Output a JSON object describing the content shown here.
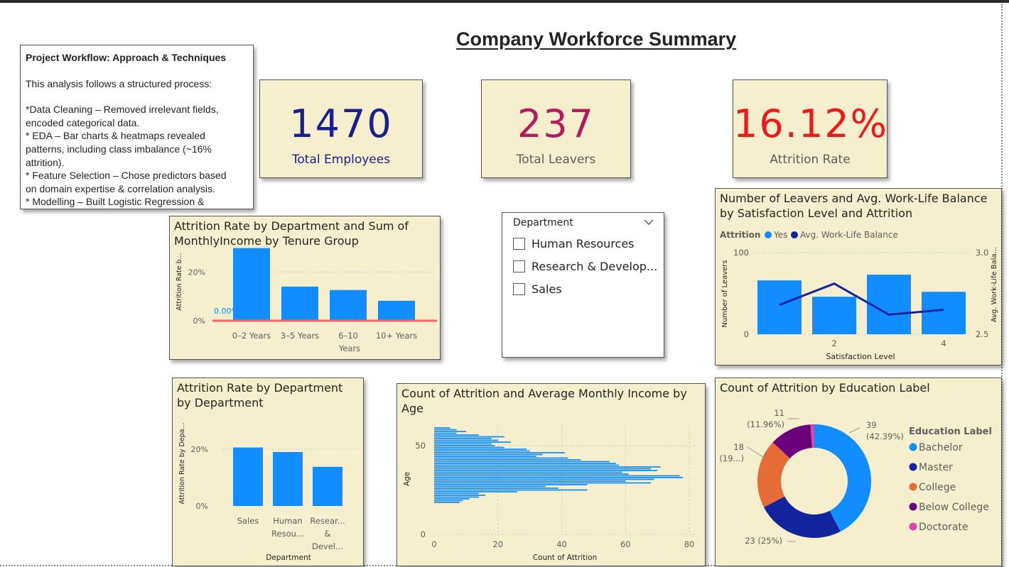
{
  "page": {
    "title": "Company Workforce Summary"
  },
  "notes": {
    "heading": "Project Workflow: Approach & Techniques",
    "intro": "This analysis follows a structured process:",
    "items": [
      "*Data Cleaning – Removed irrelevant fields, encoded categorical data.",
      "* EDA – Bar charts & heatmaps revealed patterns, including class imbalance (~16% attrition).",
      "* Feature Selection – Chose predictors based on domain expertise & correlation analysis.",
      "* Modelling – Built Logistic Regression &"
    ]
  },
  "kpis": [
    {
      "value": "1470",
      "label": "Total Employees",
      "color": "#1a1f8f"
    },
    {
      "value": "237",
      "label": "Total Leavers",
      "color": "#b5195e"
    },
    {
      "value": "16.12%",
      "label": "Attrition Rate",
      "color": "#f01818"
    }
  ],
  "slicer": {
    "title": "Department",
    "chevron": "chevron-down-icon",
    "options": [
      "Human Resources",
      "Research & Develop...",
      "Sales"
    ]
  },
  "colors": {
    "bar": "#118dff",
    "dark": "#12239e",
    "orange": "#e66c37",
    "purple": "#6b007b",
    "pink": "#e044a7",
    "panel": "#f5efce",
    "refline": "#fd625e"
  },
  "chart_data": [
    {
      "id": "tenure",
      "type": "bar",
      "title": "Attrition Rate by Department and Sum of MonthlyIncome by Tenure Group",
      "title_lines": [
        "Attrition Rate by Department and Sum of",
        "MonthlyIncome by Tenure Group"
      ],
      "ylabel": "Attrition Rate b...",
      "xlabel": "Years",
      "categories": [
        "0–2 Years",
        "3–5 Years",
        "6–10",
        "10+ Years"
      ],
      "values": [
        29.8,
        14.0,
        12.6,
        8.2
      ],
      "yticks": [
        "0%",
        "20%"
      ],
      "ylim": [
        0,
        32
      ],
      "annotation": "0.00%",
      "reference_line": 0
    },
    {
      "id": "dept",
      "type": "bar",
      "title": "Attrition Rate by Department by Department",
      "title_lines": [
        "Attrition Rate by Department",
        "by Department"
      ],
      "ylabel": "Attrition Rate by Depa...",
      "xlabel": "Department",
      "categories": [
        [
          "Sales"
        ],
        [
          "Human",
          "Resou..."
        ],
        [
          "Resear...",
          "&",
          "Devel..."
        ]
      ],
      "values": [
        20.6,
        19.0,
        13.8
      ],
      "yticks": [
        "0%",
        "20%"
      ],
      "ylim": [
        0,
        27
      ]
    },
    {
      "id": "age",
      "type": "bar",
      "orientation": "horizontal",
      "title": "Count of Attrition and Average Monthly Income by Age",
      "title_lines": [
        "Count of Attrition and Average Monthly Income by",
        "Age"
      ],
      "xlabel": "Count of Attrition",
      "ylabel": "Age",
      "xticks": [
        0,
        20,
        40,
        60,
        80
      ],
      "yticks": [
        0,
        50
      ],
      "xlim": [
        0,
        82
      ],
      "ylim": [
        0,
        62
      ],
      "ages": [
        18,
        19,
        20,
        21,
        22,
        23,
        24,
        25,
        26,
        27,
        28,
        29,
        30,
        31,
        32,
        33,
        34,
        35,
        36,
        37,
        38,
        39,
        40,
        41,
        42,
        43,
        44,
        45,
        46,
        47,
        48,
        49,
        50,
        51,
        52,
        53,
        54,
        55,
        56,
        57,
        58,
        59,
        60
      ],
      "counts": [
        8,
        9,
        11,
        14,
        16,
        14,
        26,
        48,
        39,
        35,
        48,
        68,
        60,
        69,
        78,
        77,
        61,
        59,
        70,
        68,
        71,
        58,
        57,
        55,
        46,
        42,
        32,
        34,
        41,
        30,
        29,
        22,
        19,
        18,
        24,
        20,
        18,
        22,
        14,
        7,
        10,
        7,
        5
      ]
    },
    {
      "id": "satisfaction",
      "type": "bar",
      "title": "Number of Leavers and Avg. Work-Life Balance by Satisfaction Level and Attrition",
      "title_lines": [
        "Number of Leavers and Avg. Work-Life Balance",
        "by Satisfaction Level and Attrition"
      ],
      "legend_title": "Attrition",
      "legend": [
        "Yes",
        "Avg. Work-Life Balance"
      ],
      "xlabel": "Satisfaction Level",
      "ylabel": "Number of Leavers",
      "y2label": "Avg. Work-Life Bala...",
      "x": [
        1,
        2,
        3,
        4
      ],
      "xticks": [
        2,
        4
      ],
      "values": [
        66,
        46,
        73,
        52
      ],
      "line": [
        2.68,
        2.81,
        2.62,
        2.65
      ],
      "yticks": [
        0,
        100
      ],
      "y2ticks": [
        "2.5",
        "3.0"
      ],
      "ylim": [
        0,
        100
      ],
      "y2lim": [
        2.5,
        3.0
      ]
    },
    {
      "id": "education",
      "type": "pie",
      "title": "Count of Attrition by Education Label",
      "legend_title": "Education Label",
      "labels": [
        "Bachelor",
        "Master",
        "College",
        "Below College",
        "Doctorate"
      ],
      "values": [
        39,
        23,
        18,
        11,
        1
      ],
      "colors": [
        "#118dff",
        "#12239e",
        "#e66c37",
        "#6b007b",
        "#e044a7"
      ],
      "slice_labels": [
        [
          "39",
          "(42.39%)"
        ],
        [
          "23 (25%)"
        ],
        [
          "18",
          "(19...)"
        ],
        [
          "11",
          "(11.96%)"
        ]
      ]
    }
  ]
}
